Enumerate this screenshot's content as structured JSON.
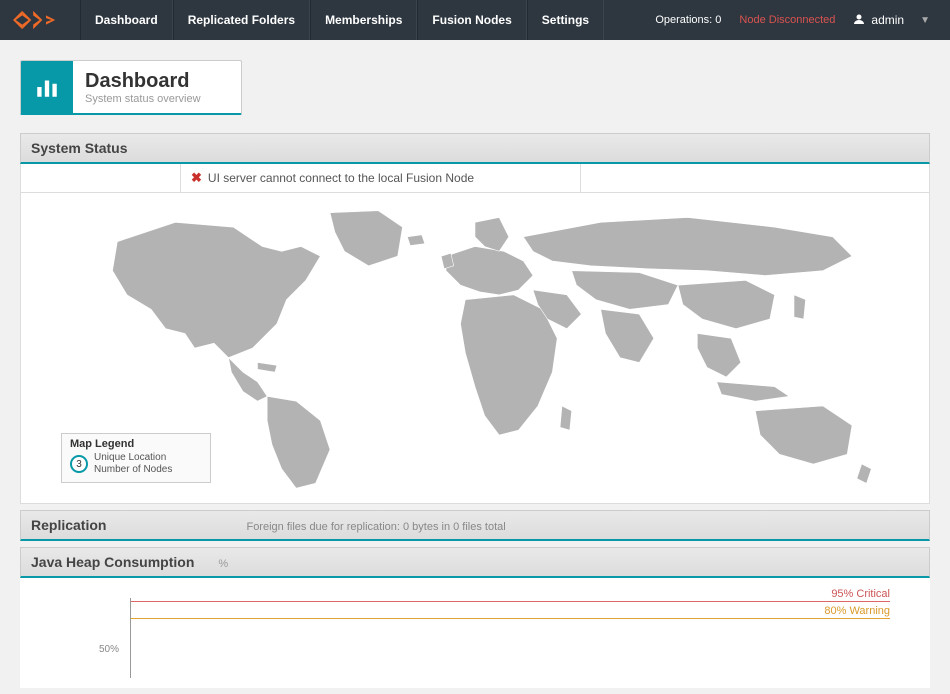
{
  "nav": {
    "items": [
      "Dashboard",
      "Replicated Folders",
      "Memberships",
      "Fusion Nodes",
      "Settings"
    ],
    "operations_label": "Operations:",
    "operations_count": "0",
    "node_status": "Node Disconnected",
    "user": "admin"
  },
  "title": {
    "heading": "Dashboard",
    "sub": "System status overview"
  },
  "panels": {
    "system_status": {
      "title": "System Status",
      "alert": "UI server cannot connect to the local Fusion Node",
      "legend_title": "Map Legend",
      "legend_count": "3",
      "legend_line1": "Unique Location",
      "legend_line2": "Number of Nodes"
    },
    "replication": {
      "title": "Replication",
      "sub": "Foreign files due for replication: 0 bytes in 0 files total"
    },
    "heap": {
      "title": "Java Heap Consumption",
      "unit": "%",
      "critical_label": "95% Critical",
      "warning_label": "80% Warning",
      "ytick_50": "50%"
    }
  },
  "chart_data": {
    "type": "line",
    "title": "Java Heap Consumption",
    "ylabel": "%",
    "ylim": [
      0,
      100
    ],
    "thresholds": [
      {
        "name": "Critical",
        "value": 95,
        "color": "#cc5555"
      },
      {
        "name": "Warning",
        "value": 80,
        "color": "#d99a2b"
      }
    ],
    "series": [
      {
        "name": "heap_usage_pct",
        "values": []
      }
    ]
  }
}
